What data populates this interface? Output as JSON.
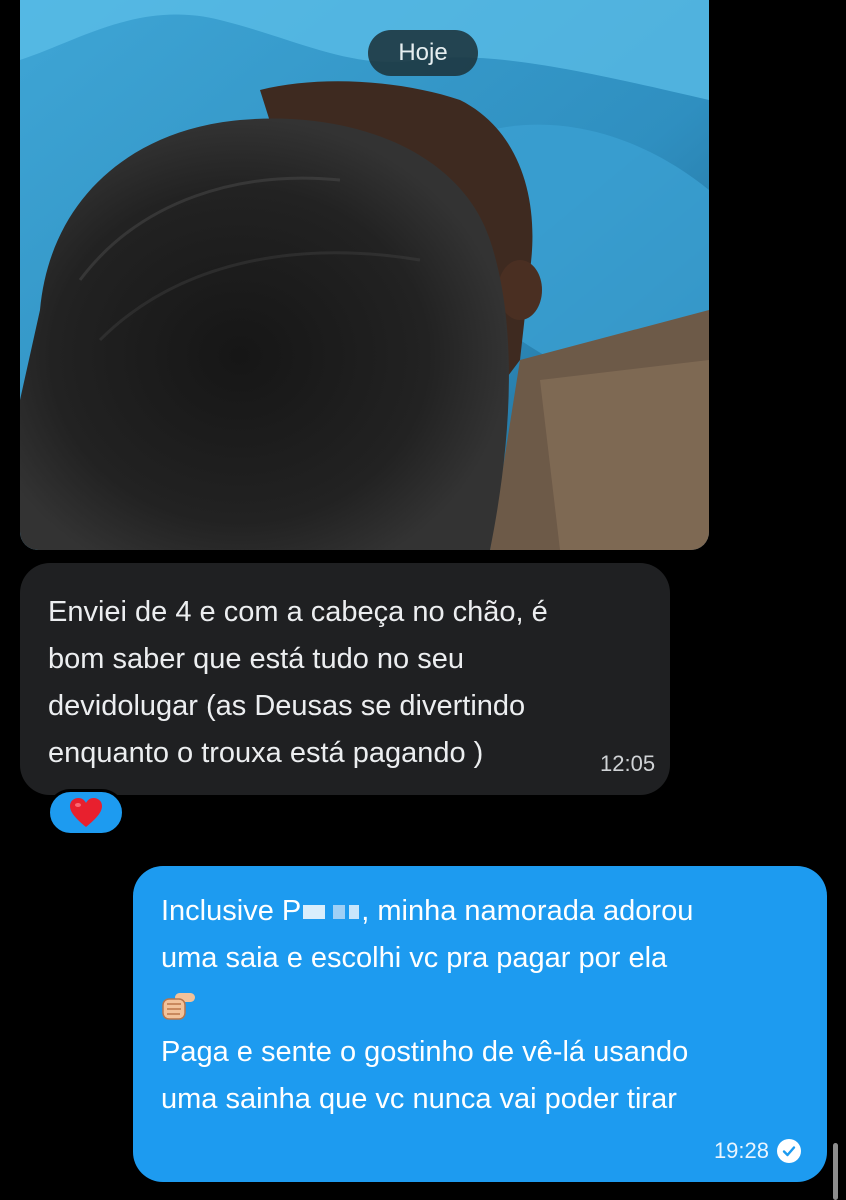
{
  "date_separator": "Hoje",
  "received_message": {
    "lines": [
      "Enviei de 4 e com a cabeça no chão, é",
      "bom saber que está tudo no seu",
      "devidolugar (as Deusas se divertindo",
      "enquanto o trouxa está pagando )"
    ],
    "time": "12:05",
    "reaction": "heart-emoji"
  },
  "sent_message": {
    "line1_prefix": "Inclusive P",
    "line1_suffix": ", minha namorada adorou",
    "line2": "uma saia e escolhi vc pra pagar por ela",
    "emoji": "pointing-finger-emoji",
    "line4": "Paga e sente o gostinho de vê-lá usando",
    "line5": "uma sainha que vc nunca vai poder tirar",
    "time": "19:28",
    "status": "read-check-icon"
  },
  "colors": {
    "background": "#000000",
    "received_bubble": "#1f2022",
    "sent_bubble": "#1d9bf0"
  }
}
